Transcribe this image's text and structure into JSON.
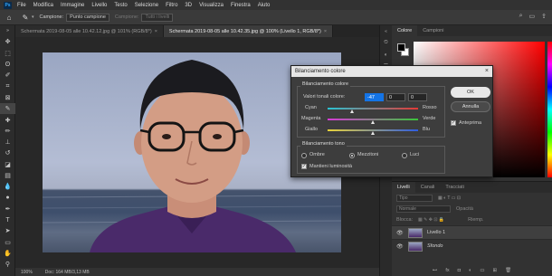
{
  "menubar": {
    "logo": "Ps",
    "items": [
      "File",
      "Modifica",
      "Immagine",
      "Livello",
      "Testo",
      "Selezione",
      "Filtro",
      "3D",
      "Visualizza",
      "Finestra",
      "Aiuto"
    ]
  },
  "options": {
    "sample_label": "Campione:",
    "sample_value": "Punto campione",
    "sample2_label": "Campione:",
    "sample2_value": "Tutti i livelli"
  },
  "tabs": [
    {
      "label": "Schermata 2019-08-05 alle 10.42.12.jpg @ 101% (RGB/8*)"
    },
    {
      "label": "Schermata 2019-08-05 alle 10.42.35.jpg @ 100% (Livello 1, RGB/8*)"
    }
  ],
  "status": {
    "zoom": "100%",
    "doc": "Doc: 164 MB/3,13 MB"
  },
  "color_panel": {
    "tab_color": "Colore",
    "tab_swatches": "Campioni"
  },
  "layers_panel": {
    "tabs": [
      "Livelli",
      "Canali",
      "Tracciati"
    ],
    "filter_placeholder": "Tipo",
    "blend_mode": "Normale",
    "opacity_label": "Opacità",
    "lock_label": "Blocca:",
    "fill_label": "Riemp.",
    "layers": [
      {
        "name": "Livello 1",
        "selected": true
      },
      {
        "name": "Sfondo",
        "selected": false
      }
    ]
  },
  "dialog": {
    "title": "Bilanciamento colore",
    "group1_title": "Bilanciamento colore",
    "levels_label": "Valori tonali colore:",
    "levels": [
      "-47",
      "0",
      "0"
    ],
    "sliders": [
      {
        "left": "Cyan",
        "right": "Rosso",
        "value": -47
      },
      {
        "left": "Magenta",
        "right": "Verde",
        "value": 0
      },
      {
        "left": "Giallo",
        "right": "Blu",
        "value": 0
      }
    ],
    "group2_title": "Bilanciamento tono",
    "tones": [
      "Ombre",
      "Mezzitoni",
      "Luci"
    ],
    "selected_tone": "Mezzitoni",
    "preserve_label": "Mantieni luminosità",
    "ok": "OK",
    "cancel": "Annulla",
    "preview": "Anteprima"
  },
  "colors": {
    "accent": "#1474e6",
    "dialog_bg": "#3d3d3d",
    "workspace": "#282828"
  }
}
